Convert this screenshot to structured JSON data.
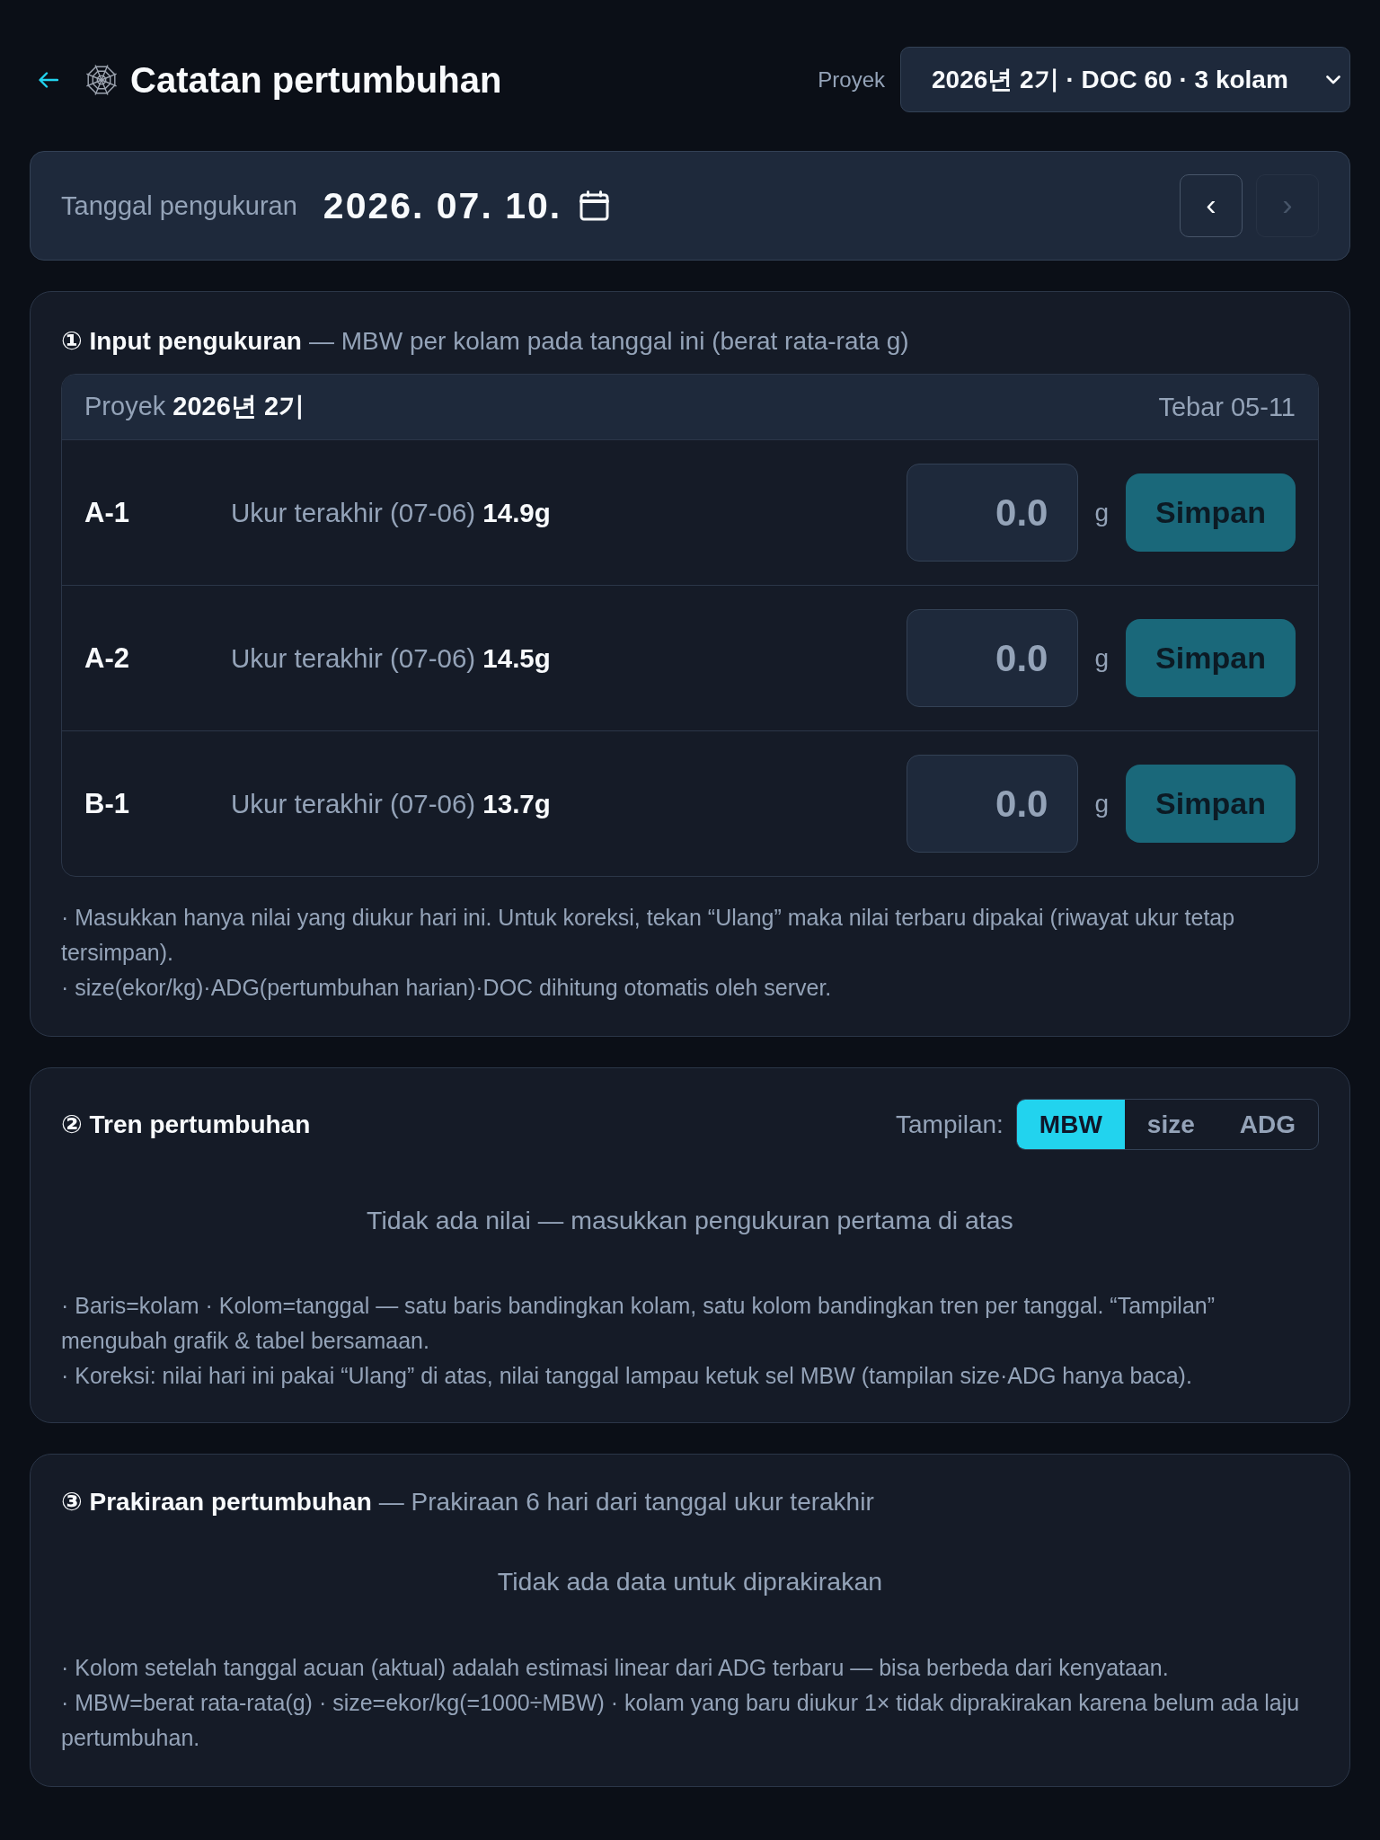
{
  "header": {
    "title": "Catatan pertumbuhan",
    "project_label": "Proyek",
    "project_select": {
      "value": "2026년 2기 · DOC 60 · 3 kolam"
    }
  },
  "date_bar": {
    "label": "Tanggal pengukuran",
    "date": "2026. 07. 10.",
    "prev_button": {
      "label": "‹",
      "disabled": false
    },
    "next_button": {
      "label": "›",
      "disabled": true
    }
  },
  "input_section": {
    "title": "① Input pengukuran",
    "subtitle": "— MBW per kolam pada tanggal ini (berat rata-rata g)",
    "table_header": {
      "project": "Proyek **2026년 2기**",
      "stocking": "Tebar 05-11"
    },
    "ponds": [
      {
        "name": "A-1",
        "last": "Ukur terakhir (07-06) **14.9g**",
        "input": {
          "placeholder": "0.0"
        },
        "unit": "g",
        "save_button": {
          "label": "Simpan",
          "disabled": true
        }
      },
      {
        "name": "A-2",
        "last": "Ukur terakhir (07-06) **14.5g**",
        "input": {
          "placeholder": "0.0"
        },
        "unit": "g",
        "save_button": {
          "label": "Simpan",
          "disabled": true
        }
      },
      {
        "name": "B-1",
        "last": "Ukur terakhir (07-06) **13.7g**",
        "input": {
          "placeholder": "0.0"
        },
        "unit": "g",
        "save_button": {
          "label": "Simpan",
          "disabled": true
        }
      }
    ],
    "notes": [
      "· Masukkan hanya nilai yang diukur hari ini. Untuk koreksi, tekan “Ulang” maka nilai terbaru dipakai (riwayat ukur tetap tersimpan).",
      "· size(ekor/kg)·ADG(pertumbuhan harian)·DOC dihitung otomatis oleh server."
    ]
  },
  "trend_section": {
    "title": "② Tren pertumbuhan",
    "view_label": "Tampilan:",
    "view_tabs": [
      {
        "label": "MBW",
        "selected": true
      },
      {
        "label": "size",
        "selected": false
      },
      {
        "label": "ADG",
        "selected": false
      }
    ],
    "empty_message": "Tidak ada nilai — masukkan pengukuran pertama di atas",
    "notes": [
      "· Baris=kolam · Kolom=tanggal — satu baris bandingkan kolam, satu kolom bandingkan tren per tanggal. “Tampilan” mengubah grafik & tabel bersamaan.",
      "· Koreksi: nilai hari ini pakai “Ulang” di atas, nilai tanggal lampau ketuk sel MBW (tampilan size·ADG hanya baca)."
    ]
  },
  "forecast_section": {
    "title": "③ Prakiraan pertumbuhan",
    "subtitle": "— Prakiraan 6 hari dari tanggal ukur terakhir",
    "empty_message": "Tidak ada data untuk diprakirakan",
    "notes": [
      "· Kolom setelah tanggal acuan (aktual) adalah estimasi linear dari ADG terbaru — bisa berbeda dari kenyataan.",
      "· MBW=berat rata-rata(g) · size=ekor/kg(=1000÷MBW) · kolam yang baru diukur 1× tidak diprakirakan karena belum ada laju pertumbuhan."
    ]
  }
}
